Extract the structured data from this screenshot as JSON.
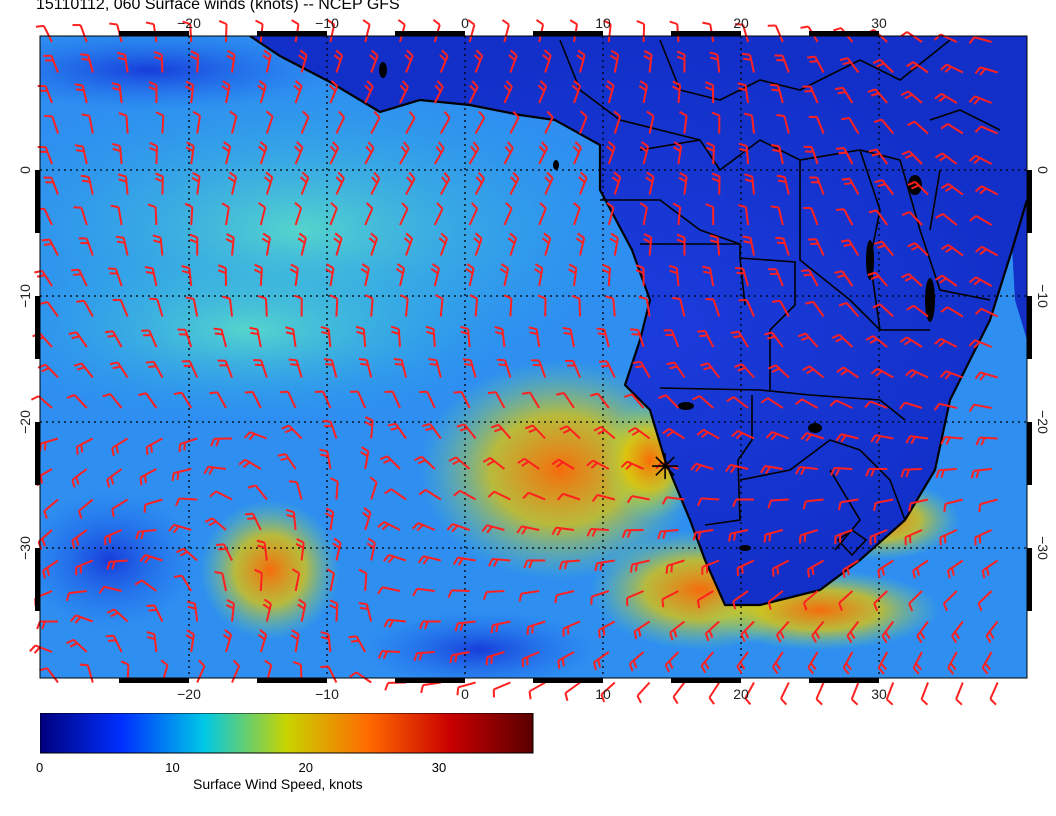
{
  "title": "15110112, 060 Surface winds (knots) -- NCEP GFS",
  "map": {
    "lon_range": [
      -30,
      40
    ],
    "lat_range": [
      -40,
      12
    ],
    "lon_ticks": [
      "−20",
      "−10",
      "0",
      "10",
      "20",
      "30"
    ],
    "lat_ticks": [
      "0",
      "−10",
      "−20",
      "−30"
    ],
    "grid": true,
    "marker": {
      "lon": 14.5,
      "lat": -23.5
    }
  },
  "colorbar": {
    "title": "Surface Wind Speed, knots",
    "labels": [
      "0",
      "10",
      "20",
      "30"
    ],
    "range": [
      0,
      37
    ],
    "colors": [
      "#00007f",
      "#0030ff",
      "#00c8e6",
      "#c8d400",
      "#ff6a00",
      "#c80000",
      "#5a0000"
    ]
  },
  "colors": {
    "barb": "#ff2020",
    "coast": "#000000",
    "background": "#ffffff"
  }
}
